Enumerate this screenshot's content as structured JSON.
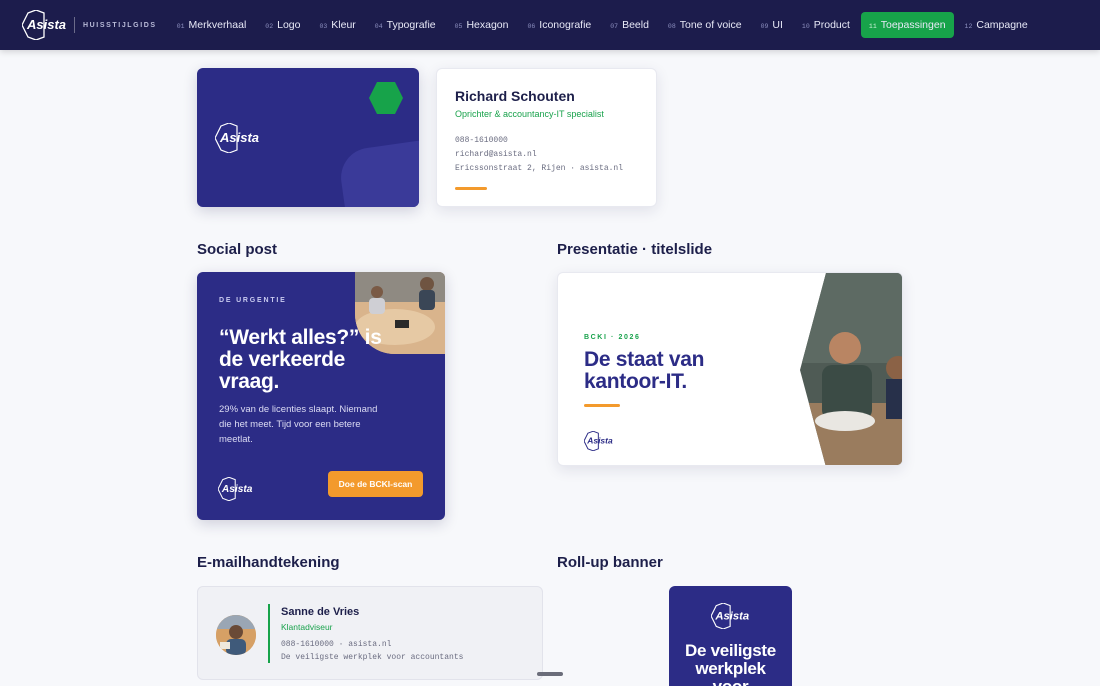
{
  "nav": {
    "brand_sub": "HUISSTIJLGIDS",
    "items": [
      {
        "num": "01",
        "label": "Merkverhaal"
      },
      {
        "num": "02",
        "label": "Logo"
      },
      {
        "num": "03",
        "label": "Kleur"
      },
      {
        "num": "04",
        "label": "Typografie"
      },
      {
        "num": "05",
        "label": "Hexagon"
      },
      {
        "num": "06",
        "label": "Iconografie"
      },
      {
        "num": "07",
        "label": "Beeld"
      },
      {
        "num": "08",
        "label": "Tone of voice"
      },
      {
        "num": "09",
        "label": "UI"
      },
      {
        "num": "10",
        "label": "Product"
      },
      {
        "num": "11",
        "label": "Toepassingen",
        "active": true
      },
      {
        "num": "12",
        "label": "Campagne"
      }
    ]
  },
  "colors": {
    "navy": "#2c2c86",
    "green": "#17a34a",
    "orange": "#f39a2c",
    "topbar": "#1c1c4c"
  },
  "logo": {
    "text": "Asista"
  },
  "business_card": {
    "name": "Richard Schouten",
    "role": "Oprichter & accountancy-IT specialist",
    "phone": "088-1610000",
    "email": "richard@asista.nl",
    "address": "Ericssonstraat 2, Rijen · asista.nl"
  },
  "social": {
    "section_title": "Social post",
    "eyebrow": "DE URGENTIE",
    "headline": "“Werkt alles?” is de verkeerde vraag.",
    "body": "29% van de licenties slaapt. Niemand die het meet. Tijd voor een betere meetlat.",
    "cta": "Doe de BCKI-scan"
  },
  "presentation": {
    "section_title": "Presentatie · titelslide",
    "eyebrow": "BCKI · 2026",
    "title": "De staat van kantoor-IT."
  },
  "email": {
    "section_title": "E-mailhandtekening",
    "name": "Sanne de Vries",
    "role": "Klantadviseur",
    "contact": "088-1610000 · asista.nl",
    "tagline": "De veiligste werkplek voor accountants"
  },
  "rollup": {
    "section_title": "Roll-up banner",
    "text": "De veiligste werkplek voor"
  }
}
